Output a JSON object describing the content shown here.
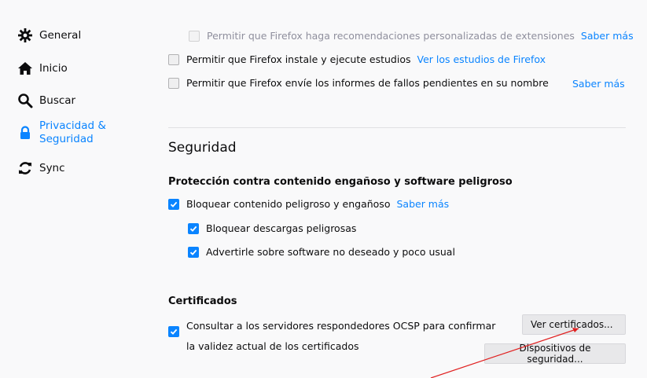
{
  "sidebar": {
    "items": [
      {
        "label": "General",
        "icon": "gear-icon"
      },
      {
        "label": "Inicio",
        "icon": "home-icon"
      },
      {
        "label": "Buscar",
        "icon": "search-icon"
      },
      {
        "label_line1": "Privacidad &",
        "label_line2": "Seguridad",
        "icon": "lock-icon",
        "selected": true
      },
      {
        "label": "Sync",
        "icon": "sync-icon"
      }
    ]
  },
  "data_collection": {
    "recommend_extensions": {
      "label": "Permitir que Firefox haga recomendaciones personalizadas de extensiones",
      "link": "Saber más",
      "checked": false,
      "disabled": true
    },
    "studies": {
      "label": "Permitir que Firefox instale y ejecute estudios",
      "link": "Ver los estudios de Firefox",
      "checked": false
    },
    "crash_reports": {
      "label": "Permitir que Firefox envíe los informes de fallos pendientes en su nombre",
      "link": "Saber más",
      "checked": false
    }
  },
  "security": {
    "title": "Seguridad",
    "protection_title": "Protección contra contenido engañoso y software peligroso",
    "block_dangerous": {
      "label": "Bloquear contenido peligroso y engañoso",
      "link": "Saber más",
      "checked": true
    },
    "block_downloads": {
      "label": "Bloquear descargas peligrosas",
      "checked": true
    },
    "warn_unwanted": {
      "label": "Advertirle sobre software no deseado y poco usual",
      "checked": true
    }
  },
  "certificates": {
    "title": "Certificados",
    "ocsp": {
      "line1": "Consultar a los servidores respondedores OCSP para confirmar",
      "line2": "la validez actual de los certificados",
      "checked": true
    },
    "view_button": "Ver certificados...",
    "devices_button": "Dispositivos de seguridad..."
  },
  "colors": {
    "accent": "#0a84ff",
    "annotation": "#e02020"
  }
}
